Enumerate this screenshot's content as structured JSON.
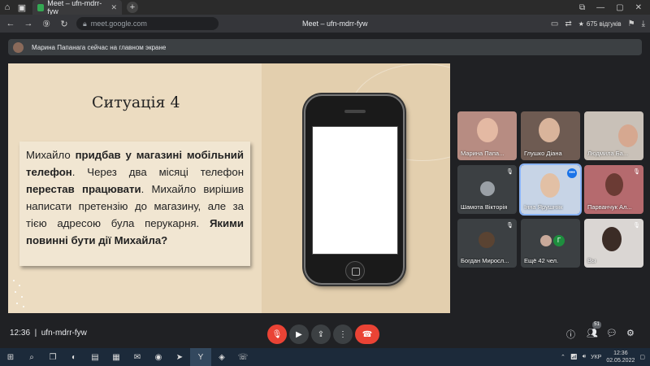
{
  "browser": {
    "tab_title": "Meet – ufn-mdrr-fyw",
    "url": "meet.google.com",
    "page_title": "Meet – ufn-mdrr-fyw",
    "reviews": "675 відгуків"
  },
  "notice": {
    "text": "Марина Папанага сейчас на главном экране"
  },
  "slide": {
    "title": "Ситуація 4",
    "p1_a": "Михайло ",
    "p1_b": "придбав у магазині мобільний телефон",
    "p1_c": ". Через два місяці телефон ",
    "p1_d": "перестав працювати",
    "p1_e": ". Михайло вирішив написати претензію до магазину, але за тією адресою була перукарня. ",
    "p1_f": "Якими повинні бути дії Михайла?"
  },
  "participants": [
    {
      "name": "Марина Папа..."
    },
    {
      "name": "Глушко Діана"
    },
    {
      "name": "Людмила Ба..."
    },
    {
      "name": "Шамота Вікторія"
    },
    {
      "name": "Інна Ярушняк"
    },
    {
      "name": "Парванчук Ал..."
    },
    {
      "name": "Богдан Миросл..."
    },
    {
      "name": "Ещё 42 чел.",
      "avatar_letter": "Г"
    },
    {
      "name": "Вы"
    }
  ],
  "controls": {
    "time": "12:36",
    "meeting_code": "ufn-mdrr-fyw",
    "people_count": "51"
  },
  "taskbar": {
    "lang": "УКР",
    "time": "12:36",
    "date": "02.05.2022"
  }
}
